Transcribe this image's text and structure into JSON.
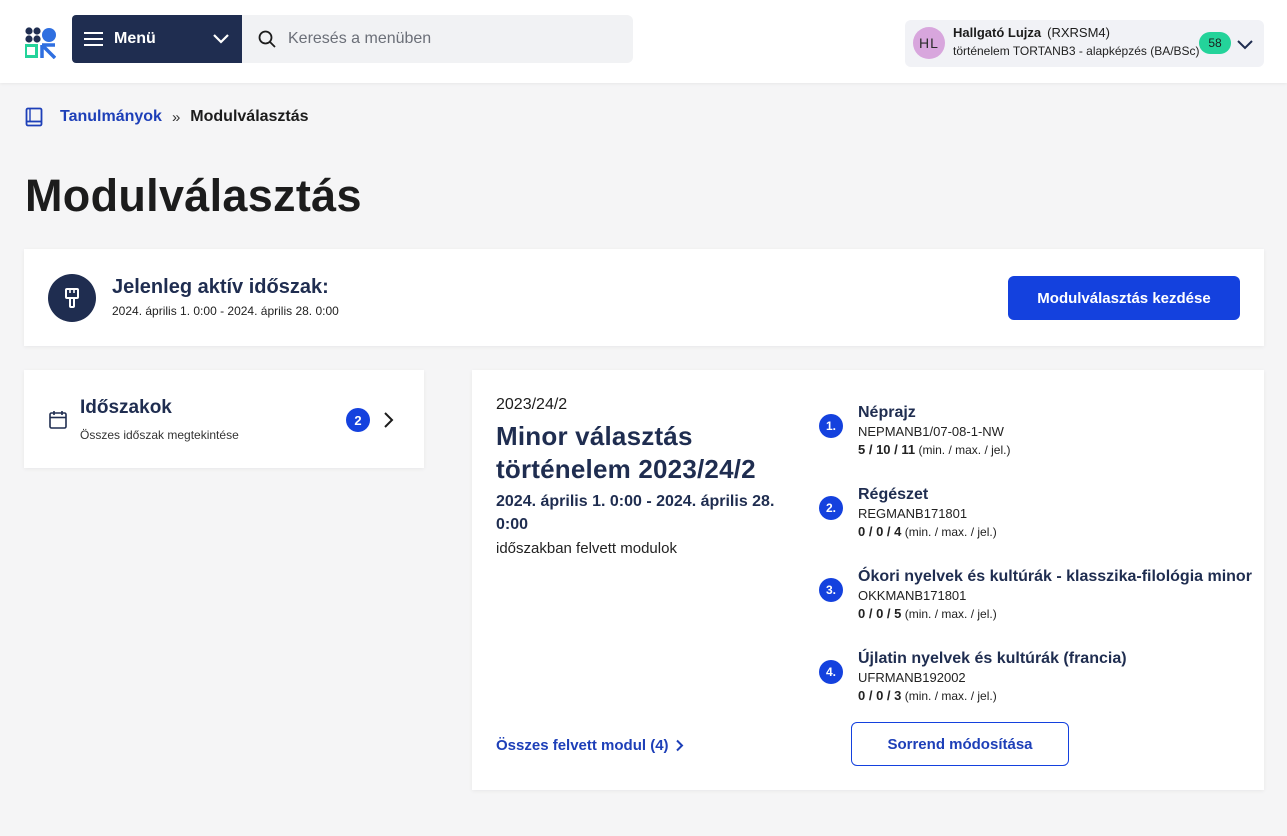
{
  "header": {
    "menu_label": "Menü",
    "search_placeholder": "Keresés a menüben",
    "user": {
      "initials": "HL",
      "name": "Hallgató Lujza",
      "code": "(RXRSM4)",
      "program": "történelem TORTANB3 - alapképzés (BA/BSc)",
      "notification_count": "58"
    }
  },
  "breadcrumb": {
    "parent": "Tanulmányok",
    "separator": "»",
    "current": "Modulválasztás"
  },
  "page_title": "Modulválasztás",
  "active_period": {
    "title": "Jelenleg aktív időszak:",
    "range": "2024. április 1. 0:00 - 2024. április 28. 0:00",
    "start_button": "Modulválasztás kezdése"
  },
  "periods_card": {
    "title": "Időszakok",
    "subtitle": "Összes időszak megtekintése",
    "count": "2"
  },
  "detail": {
    "semester": "2023/24/2",
    "title": "Minor választás történelem 2023/24/2",
    "range": "2024. április 1. 0:00 - 2024. április 28. 0:00",
    "note": "időszakban felvett modulok",
    "all_modules_link": "Összes felvett modul (4)",
    "reorder_button": "Sorrend módosítása",
    "stats_suffix": "(min. / max. / jel.)",
    "modules": [
      {
        "num": "1.",
        "name": "Néprajz",
        "code": "NEPMANB1/07-08-1-NW",
        "stats": "5 / 10 / 11"
      },
      {
        "num": "2.",
        "name": "Régészet",
        "code": "REGMANB171801",
        "stats": "0 / 0 / 4"
      },
      {
        "num": "3.",
        "name": "Ókori nyelvek és kultúrák - klasszika-filológia minor",
        "code": "OKKMANB171801",
        "stats": "0 / 0 / 5"
      },
      {
        "num": "4.",
        "name": "Újlatin nyelvek és kultúrák (francia)",
        "code": "UFRMANB192002",
        "stats": "0 / 0 / 3"
      }
    ]
  },
  "colors": {
    "navy": "#1f2d50",
    "primary_blue": "#1441de",
    "link_blue": "#1d3fb8",
    "badge_green": "#24d39a",
    "avatar_pink": "#d8a6dd"
  }
}
